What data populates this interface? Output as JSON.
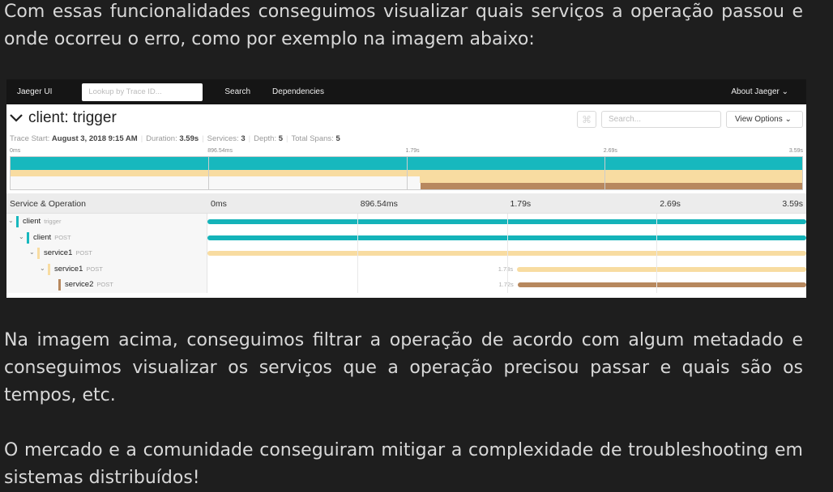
{
  "text": {
    "p1": "Com essas funcionalidades conseguimos visualizar quais serviços a operação passou e onde ocorreu o erro, como por exemplo na imagem abaixo:",
    "p2": "Na imagem acima, conseguimos filtrar a operação de acordo com algum metadado e conseguimos visualizar os serviços que a operação precisou passar e quais são os tempos, etc.",
    "p3": "O mercado e a comunidade conseguiram mitigar a complexidade de troubleshooting em sistemas distribuídos!"
  },
  "jaeger": {
    "nav": {
      "brand": "Jaeger UI",
      "lookup_placeholder": "Lookup by Trace ID...",
      "search": "Search",
      "dependencies": "Dependencies",
      "about": "About Jaeger ⌄"
    },
    "title": "client: trigger",
    "tools": {
      "cmd": "⌘",
      "search_placeholder": "Search...",
      "view_options": "View Options ⌄"
    },
    "meta": {
      "start_label": "Trace Start:",
      "start": "August 3, 2018 9:15 AM",
      "duration_label": "Duration:",
      "duration": "3.59s",
      "services_label": "Services:",
      "services": "3",
      "depth_label": "Depth:",
      "depth": "5",
      "spans_label": "Total Spans:",
      "spans": "5"
    },
    "ticks": [
      "0ms",
      "896.54ms",
      "1.79s",
      "2.69s",
      "3.59s"
    ],
    "header": "Service & Operation",
    "colors": {
      "client": "#17b8be",
      "service1": "#f8dca1",
      "service2": "#b7885e"
    },
    "spans": [
      {
        "service": "client",
        "op": "trigger",
        "depth": 0,
        "start": 0,
        "end": 1,
        "dur": ""
      },
      {
        "service": "client",
        "op": "POST",
        "depth": 1,
        "start": 0,
        "end": 1,
        "dur": ""
      },
      {
        "service": "service1",
        "op": "POST",
        "depth": 2,
        "start": 0,
        "end": 1,
        "dur": ""
      },
      {
        "service": "service1",
        "op": "POST",
        "depth": 3,
        "start": 0.517,
        "end": 1,
        "dur": "1.73s"
      },
      {
        "service": "service2",
        "op": "POST",
        "depth": 4,
        "start": 0.518,
        "end": 1,
        "dur": "1.72s"
      }
    ]
  }
}
